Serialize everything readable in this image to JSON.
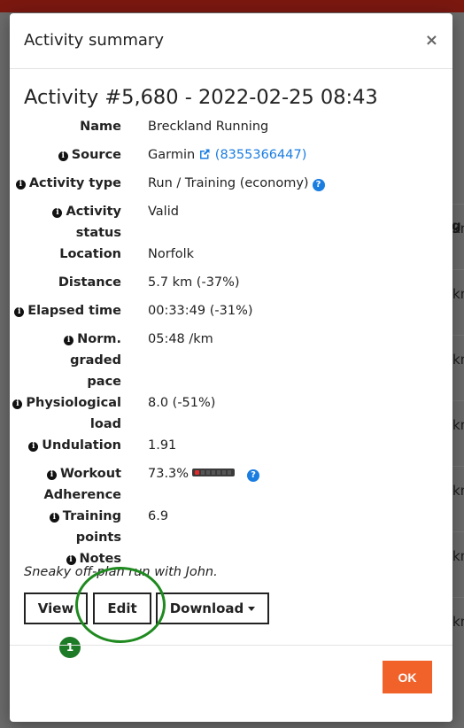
{
  "modal": {
    "title": "Activity summary",
    "close_symbol": "×",
    "heading": "Activity #5,680 - 2022-02-25 08:43"
  },
  "details": {
    "name": {
      "label": "Name",
      "value": "Breckland Running"
    },
    "source": {
      "label": "Source",
      "value": "Garmin",
      "link_text": "(8355366447)"
    },
    "activity_type": {
      "label": "Activity type",
      "value": "Run / Training (economy)"
    },
    "activity_status": {
      "label": "Activity status",
      "label_line1": "Activity",
      "label_line2": "status",
      "value": "Valid"
    },
    "location": {
      "label": "Location",
      "value": "Norfolk"
    },
    "distance": {
      "label": "Distance",
      "value": "5.7 km (-37%)"
    },
    "elapsed_time": {
      "label": "Elapsed time",
      "value": "00:33:49 (-31%)"
    },
    "norm_graded_pace": {
      "label_line1": "Norm. graded",
      "label_line2": "pace",
      "value": "05:48 /km"
    },
    "physiological_load": {
      "label_line1": "Physiological",
      "label_line2": "load",
      "value": "8.0 (-51%)"
    },
    "undulation": {
      "label": "Undulation",
      "value": "1.91"
    },
    "workout_adherence": {
      "label_line1": "Workout",
      "label_line2": "Adherence",
      "value": "73.3%",
      "level_fraction": 0.733
    },
    "training_points": {
      "label_line1": "Training",
      "label_line2": "points",
      "value": "6.9"
    },
    "notes": {
      "label": "Notes",
      "value": "Sneaky off-plan run with John."
    }
  },
  "buttons": {
    "view": "View",
    "edit": "Edit",
    "download": "Download",
    "ok": "OK"
  },
  "annotation": {
    "badge": "1"
  },
  "colors": {
    "accent_link": "#1a7de0",
    "ok_button": "#f0622a",
    "annotation_green": "#1d7a26",
    "topbar": "#7a1810"
  },
  "background": {
    "cells": [
      "/km",
      "/km",
      "/km",
      "/km",
      "/km",
      "/km",
      "/km"
    ],
    "header_fragment": "g"
  }
}
